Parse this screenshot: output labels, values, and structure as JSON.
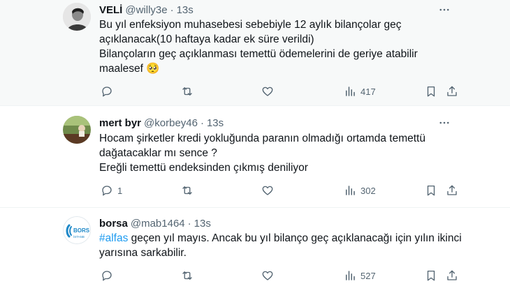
{
  "tweets": [
    {
      "name": "VELİ",
      "handle": "@willy3e",
      "separator": "·",
      "time": "13s",
      "lines": [
        "Bu yıl enfeksiyon muhasebesi sebebiyle 12 aylık bilançolar geç",
        "açıklanacak(10 haftaya kadar ek süre verildi)",
        "Bilançoların geç açıklanması temettü ödemelerini de geriye atabilir",
        "maalesef 🥺"
      ],
      "replies": "",
      "retweets": "",
      "likes": "",
      "views": "417"
    },
    {
      "name": "mert byr",
      "handle": "@korbey46",
      "separator": "·",
      "time": "13s",
      "lines": [
        "Hocam şirketler kredi yokluğunda paranın olmadığı ortamda temettü",
        "dağatacaklar mı sence ?",
        "Ereğli temettü endeksinden çıkmış deniliyor"
      ],
      "replies": "1",
      "retweets": "",
      "likes": "",
      "views": "302"
    },
    {
      "name": "borsa",
      "handle": "@mab1464",
      "separator": "·",
      "time": "13s",
      "avatar_text": "BORS",
      "avatar_subtext": "İSTANB",
      "hashtag": "#alfas",
      "line1_rest": " geçen yıl mayıs. Ancak bu yıl bilanço geç açıklanacağı için yılın ikinci",
      "line2": "yarısına sarkabilir.",
      "replies": "",
      "retweets": "",
      "likes": "",
      "views": "527"
    }
  ],
  "icons": [
    "reply-icon",
    "retweet-icon",
    "like-icon",
    "views-icon",
    "bookmark-icon",
    "share-icon",
    "more-icon"
  ],
  "colors": {
    "text": "#0f1419",
    "secondary": "#536471",
    "link": "#1d9bf0",
    "hover_bg": "#f7f9f9"
  }
}
